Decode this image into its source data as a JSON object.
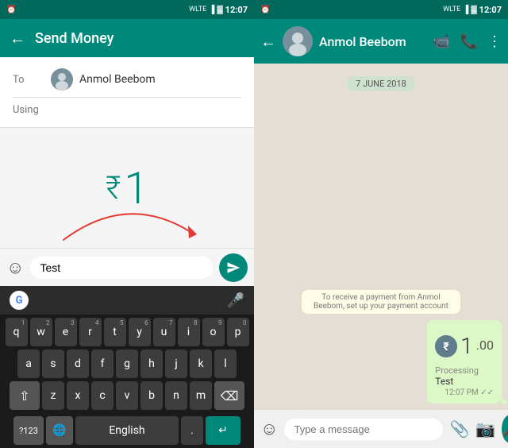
{
  "left": {
    "statusBar": {
      "time": "12:07",
      "icons": "WLTE signal wifi battery"
    },
    "header": {
      "title": "Send Money",
      "backLabel": "←"
    },
    "form": {
      "toLabel": "To",
      "usingLabel": "Using",
      "recipientName": "Anmol Beebom"
    },
    "amount": {
      "symbol": "₹",
      "value": "1"
    },
    "messageBar": {
      "emojiIcon": "☺",
      "inputValue": "Test",
      "inputPlaceholder": "Test",
      "sendIcon": "▶"
    },
    "keyboard": {
      "googleIcon": "G",
      "micIcon": "🎤",
      "rows": [
        [
          "q",
          "w",
          "e",
          "r",
          "t",
          "y",
          "u",
          "i",
          "o",
          "p"
        ],
        [
          "a",
          "s",
          "d",
          "f",
          "g",
          "h",
          "j",
          "k",
          "l"
        ],
        [
          "z",
          "x",
          "c",
          "v",
          "b",
          "n",
          "m"
        ]
      ],
      "superscripts": [
        "1",
        "2",
        "3",
        "4",
        "5",
        "6",
        "7",
        "8",
        "9",
        "0"
      ],
      "numKey": "?123",
      "globeKey": "🌐",
      "langKey": "English",
      "periodKey": ".",
      "enterKey": "↵",
      "shiftIcon": "⇧",
      "deleteIcon": "⌫"
    }
  },
  "right": {
    "statusBar": {
      "time": "12:07"
    },
    "header": {
      "name": "Anmol Beebom",
      "backIcon": "←",
      "videoIcon": "📹",
      "callIcon": "📞",
      "moreIcon": "⋮"
    },
    "chat": {
      "dateBadge": "7 JUNE 2018",
      "systemMessage": "To receive a payment from Anmol Beebom, set up your payment account",
      "payment": {
        "coinIcon": "₹",
        "amount": "1",
        "decimal": ".00",
        "status": "Processing",
        "note": "Test",
        "time": "12:07 PM ✓✓"
      }
    },
    "inputBar": {
      "emojiIcon": "☺",
      "placeholder": "Type a message",
      "attachIcon": "📎",
      "cameraIcon": "📷",
      "micIcon": "🎤"
    }
  }
}
